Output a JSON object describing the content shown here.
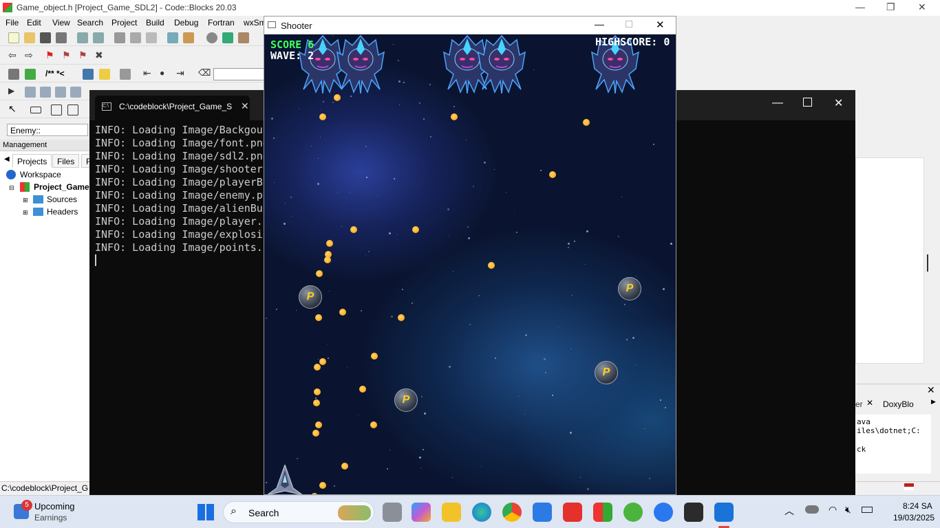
{
  "codeblocks": {
    "title": "Game_object.h [Project_Game_SDL2] - Code::Blocks 20.03",
    "menu": [
      "File",
      "Edit",
      "View",
      "Search",
      "Project",
      "Build",
      "Debug",
      "Fortran",
      "wxSm"
    ],
    "symbol_box": "Enemy::",
    "management": {
      "header": "Management",
      "tabs": [
        "Projects",
        "Files",
        "F"
      ],
      "tree": {
        "workspace": "Workspace",
        "project": "Project_Game_",
        "sources": "Sources",
        "headers": "Headers"
      }
    },
    "status": "C:\\codeblock\\Project_G",
    "right_log": {
      "tab1": "er",
      "tab2": "DoxyBlo",
      "lines": [
        "ava",
        "iles\\dotnet;C:",
        "ck"
      ]
    }
  },
  "console": {
    "tab_title": "C:\\codeblock\\Project_Game_S",
    "lines": [
      "INFO: Loading Image/Backgour",
      "INFO: Loading Image/font.png",
      "INFO: Loading Image/sdl2.png",
      "INFO: Loading Image/shooter",
      "INFO: Loading Image/playerBu",
      "INFO: Loading Image/enemy.pr",
      "INFO: Loading Image/alienBu",
      "INFO: Loading Image/player.",
      "INFO: Loading Image/explosic",
      "INFO: Loading Image/points.p"
    ]
  },
  "game": {
    "window_title": "Shooter",
    "score_label": "SCORE 6",
    "wave_label": "WAVE: 2",
    "highscore_label": "HIGHSCORE: 0",
    "powerup_letter": "P"
  },
  "taskbar": {
    "widget_title": "Upcoming",
    "widget_sub": "Earnings",
    "widget_badge": "5",
    "search": "Search",
    "time": "8:24 SA",
    "date": "19/03/2025"
  }
}
